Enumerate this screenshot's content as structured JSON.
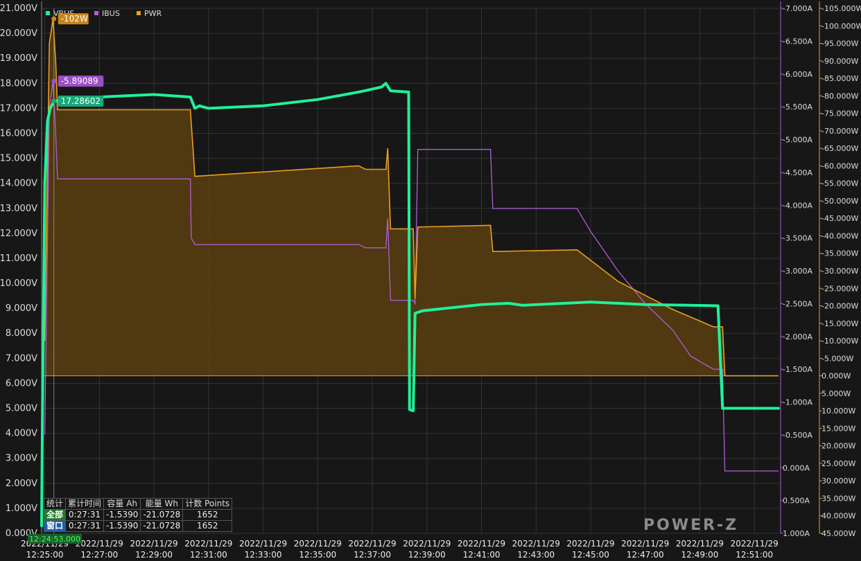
{
  "chart_data": {
    "type": "line",
    "legend": {
      "placement": "top-left"
    },
    "colors": {
      "VBUS": "#1ef29a",
      "IBUS": "#b05fd6",
      "PWR": "#e8a020",
      "pwr_fill": "#5a3e10",
      "grid": "#333333",
      "background": "#171717"
    },
    "axes": {
      "left": {
        "series": "VBUS",
        "min": 0,
        "max": 21,
        "step": 1,
        "decimals": 3,
        "unit": "V"
      },
      "right1": {
        "series": "IBUS",
        "min": 1.0,
        "max": -7.0,
        "step": -0.5,
        "decimals": 3,
        "unit": "A"
      },
      "right2": {
        "series": "PWR",
        "min": 45,
        "max": -105,
        "step": -5,
        "decimals": 3,
        "unit": "W"
      }
    },
    "x_axis": {
      "start": "12:24:53",
      "end": "12:51:53",
      "ticks": [
        {
          "t": "12:25:00",
          "date": "2022/11/29",
          "time": "12:25:00"
        },
        {
          "t": "12:27:00",
          "date": "2022/11/29",
          "time": "12:27:00"
        },
        {
          "t": "12:29:00",
          "date": "2022/11/29",
          "time": "12:29:00"
        },
        {
          "t": "12:31:00",
          "date": "2022/11/29",
          "time": "12:31:00"
        },
        {
          "t": "12:33:00",
          "date": "2022/11/29",
          "time": "12:33:00"
        },
        {
          "t": "12:35:00",
          "date": "2022/11/29",
          "time": "12:35:00"
        },
        {
          "t": "12:37:00",
          "date": "2022/11/29",
          "time": "12:37:00"
        },
        {
          "t": "12:39:00",
          "date": "2022/11/29",
          "time": "12:39:00"
        },
        {
          "t": "12:41:00",
          "date": "2022/11/29",
          "time": "12:41:00"
        },
        {
          "t": "12:43:00",
          "date": "2022/11/29",
          "time": "12:43:00"
        },
        {
          "t": "12:45:00",
          "date": "2022/11/29",
          "time": "12:45:00"
        },
        {
          "t": "12:47:00",
          "date": "2022/11/29",
          "time": "12:47:00"
        },
        {
          "t": "12:49:00",
          "date": "2022/11/29",
          "time": "12:49:00"
        },
        {
          "t": "12:51:00",
          "date": "2022/11/29",
          "time": "12:51:00"
        }
      ]
    },
    "cursor": {
      "t": "12:25:20",
      "time_label": "12:24:53.000"
    },
    "markers": {
      "VBUS": "17.28602",
      "IBUS": "-5.89089",
      "PWR": "-102W"
    },
    "series": [
      {
        "name": "VBUS",
        "points": [
          [
            "12:24:53",
            0.3
          ],
          [
            "12:24:55",
            5
          ],
          [
            "12:25:00",
            14
          ],
          [
            "12:25:06",
            16.5
          ],
          [
            "12:25:12",
            17.0
          ],
          [
            "12:25:20",
            17.28
          ],
          [
            "12:26:00",
            17.35
          ],
          [
            "12:27:00",
            17.45
          ],
          [
            "12:28:00",
            17.5
          ],
          [
            "12:29:00",
            17.55
          ],
          [
            "12:30:20",
            17.45
          ],
          [
            "12:30:30",
            17.0
          ],
          [
            "12:30:40",
            17.1
          ],
          [
            "12:31:00",
            17.0
          ],
          [
            "12:33:00",
            17.1
          ],
          [
            "12:35:00",
            17.35
          ],
          [
            "12:36:30",
            17.65
          ],
          [
            "12:37:20",
            17.85
          ],
          [
            "12:37:30",
            18.0
          ],
          [
            "12:37:40",
            17.7
          ],
          [
            "12:38:20",
            17.65
          ],
          [
            "12:38:22",
            4.95
          ],
          [
            "12:38:30",
            4.9
          ],
          [
            "12:38:34",
            8.8
          ],
          [
            "12:38:50",
            8.9
          ],
          [
            "12:41:00",
            9.15
          ],
          [
            "12:42:00",
            9.2
          ],
          [
            "12:42:30",
            9.12
          ],
          [
            "12:45:00",
            9.25
          ],
          [
            "12:47:00",
            9.15
          ],
          [
            "12:49:40",
            9.1
          ],
          [
            "12:49:50",
            5.0
          ],
          [
            "12:51:53",
            5.0
          ]
        ]
      },
      {
        "name": "IBUS",
        "points": [
          [
            "12:25:00",
            -0.5
          ],
          [
            "12:25:10",
            -5.5
          ],
          [
            "12:25:18",
            -5.89
          ],
          [
            "12:25:24",
            -5.1
          ],
          [
            "12:25:28",
            -4.4
          ],
          [
            "12:30:20",
            -4.4
          ],
          [
            "12:30:22",
            -3.5
          ],
          [
            "12:30:30",
            -3.4
          ],
          [
            "12:36:30",
            -3.4
          ],
          [
            "12:36:45",
            -3.35
          ],
          [
            "12:37:30",
            -3.35
          ],
          [
            "12:37:34",
            -3.8
          ],
          [
            "12:37:40",
            -2.55
          ],
          [
            "12:38:30",
            -2.55
          ],
          [
            "12:38:34",
            -2.5
          ],
          [
            "12:38:40",
            -4.85
          ],
          [
            "12:41:20",
            -4.85
          ],
          [
            "12:41:25",
            -3.95
          ],
          [
            "12:44:30",
            -3.95
          ],
          [
            "12:45:00",
            -3.6
          ],
          [
            "12:46:00",
            -3.0
          ],
          [
            "12:47:00",
            -2.5
          ],
          [
            "12:48:00",
            -2.1
          ],
          [
            "12:48:40",
            -1.7
          ],
          [
            "12:49:30",
            -1.5
          ],
          [
            "12:49:50",
            -1.5
          ],
          [
            "12:49:55",
            0.05
          ],
          [
            "12:51:53",
            0.05
          ]
        ]
      },
      {
        "name": "PWR",
        "points": [
          [
            "12:25:00",
            -10
          ],
          [
            "12:25:10",
            -95
          ],
          [
            "12:25:18",
            -102
          ],
          [
            "12:25:24",
            -90
          ],
          [
            "12:25:28",
            -76
          ],
          [
            "12:30:20",
            -76
          ],
          [
            "12:30:30",
            -57
          ],
          [
            "12:36:30",
            -60
          ],
          [
            "12:36:45",
            -59
          ],
          [
            "12:37:30",
            -59
          ],
          [
            "12:37:34",
            -65
          ],
          [
            "12:37:40",
            -42
          ],
          [
            "12:38:30",
            -42
          ],
          [
            "12:38:34",
            -22
          ],
          [
            "12:38:40",
            -42.5
          ],
          [
            "12:41:20",
            -43
          ],
          [
            "12:41:25",
            -35.5
          ],
          [
            "12:44:30",
            -36
          ],
          [
            "12:45:00",
            -33
          ],
          [
            "12:46:00",
            -27
          ],
          [
            "12:47:00",
            -23
          ],
          [
            "12:48:00",
            -19
          ],
          [
            "12:49:30",
            -14
          ],
          [
            "12:49:50",
            -14
          ],
          [
            "12:49:55",
            0
          ],
          [
            "12:51:53",
            0
          ]
        ]
      }
    ]
  },
  "stats": {
    "header": [
      "统计",
      "累计时间",
      "容量 Ah",
      "能量 Wh",
      "计数 Points"
    ],
    "rows": [
      [
        "全部",
        "0:27:31",
        "-1.5390",
        "-21.0728",
        "1652"
      ],
      [
        "窗口",
        "0:27:31",
        "-1.5390",
        "-21.0728",
        "1652"
      ]
    ]
  },
  "logo": "POWER-Z"
}
